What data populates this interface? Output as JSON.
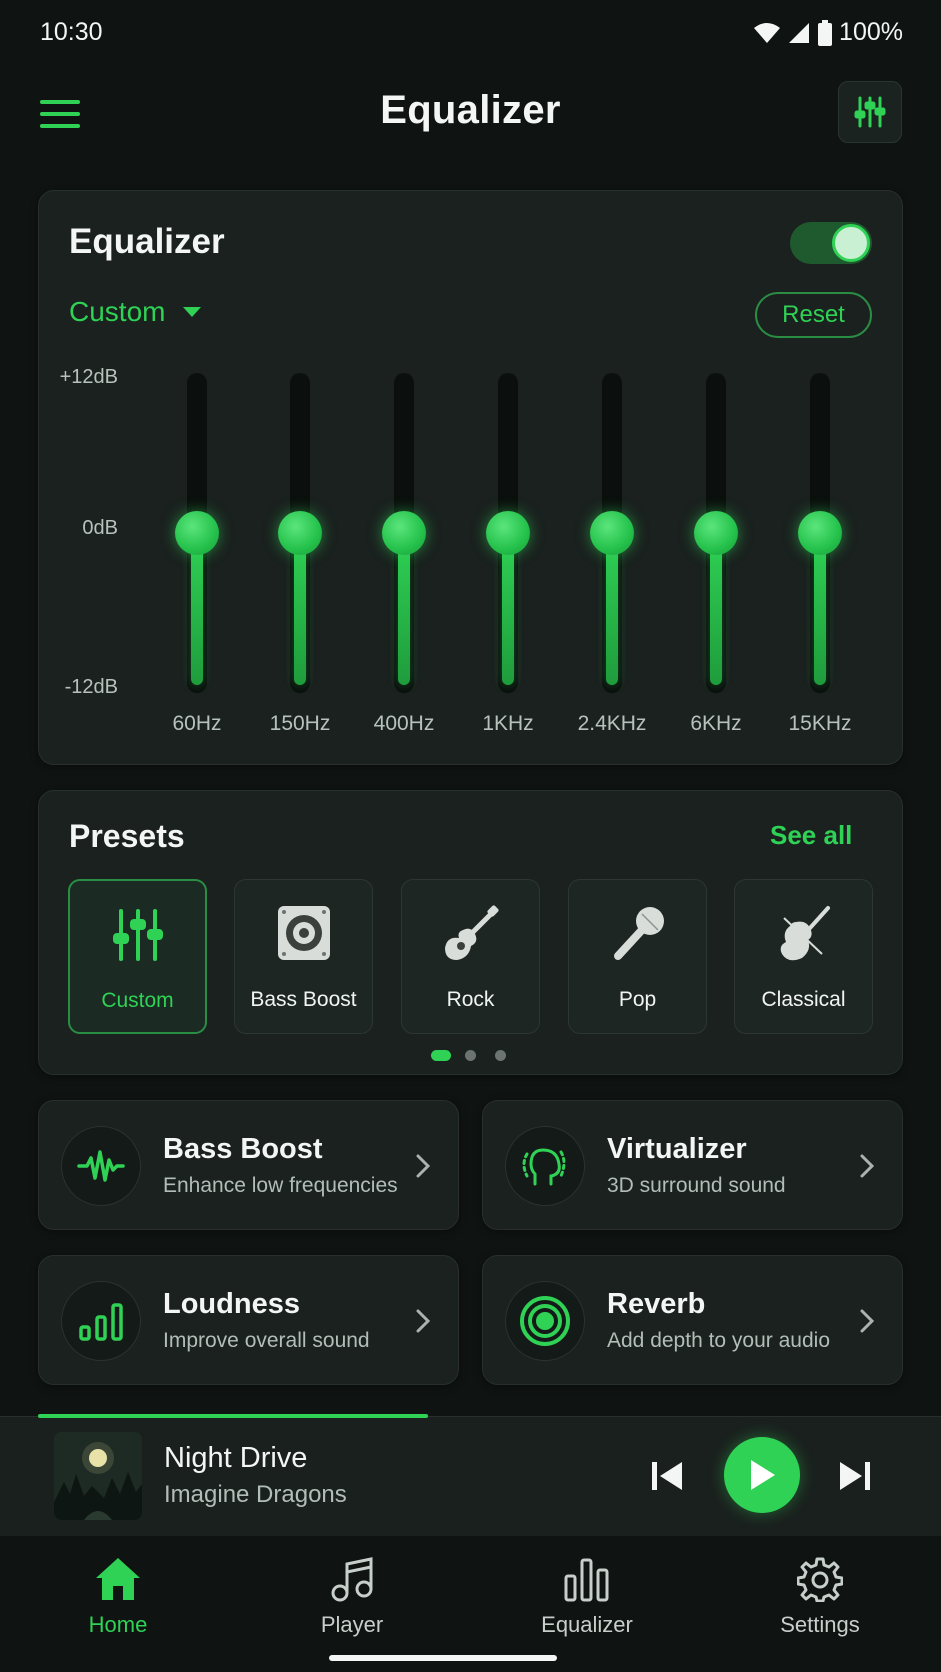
{
  "status_bar": {
    "time": "10:30",
    "battery": "100%"
  },
  "header": {
    "title": "Equalizer"
  },
  "equalizer": {
    "title": "Equalizer",
    "enabled": true,
    "preset": "Custom",
    "reset_label": "Reset",
    "db_labels": {
      "max": "+12dB",
      "mid": "0dB",
      "min": "-12dB"
    },
    "bands": [
      {
        "freq": "60Hz",
        "gain_db": 0
      },
      {
        "freq": "150Hz",
        "gain_db": 0
      },
      {
        "freq": "400Hz",
        "gain_db": 0
      },
      {
        "freq": "1KHz",
        "gain_db": 0
      },
      {
        "freq": "2.4KHz",
        "gain_db": 0
      },
      {
        "freq": "6KHz",
        "gain_db": 0
      },
      {
        "freq": "15KHz",
        "gain_db": 0
      }
    ]
  },
  "presets": {
    "title": "Presets",
    "see_all": "See all",
    "items": [
      {
        "label": "Custom",
        "icon": "sliders-icon",
        "active": true
      },
      {
        "label": "Bass Boost",
        "icon": "speaker-icon",
        "active": false
      },
      {
        "label": "Rock",
        "icon": "guitar-icon",
        "active": false
      },
      {
        "label": "Pop",
        "icon": "microphone-icon",
        "active": false
      },
      {
        "label": "Classical",
        "icon": "violin-icon",
        "active": false
      }
    ],
    "page_index": 0,
    "page_count": 3
  },
  "features": [
    {
      "title": "Bass Boost",
      "subtitle": "Enhance low frequencies",
      "icon": "waveform-icon"
    },
    {
      "title": "Virtualizer",
      "subtitle": "3D surround sound",
      "icon": "head-surround-icon"
    },
    {
      "title": "Loudness",
      "subtitle": "Improve overall sound",
      "icon": "level-bars-icon"
    },
    {
      "title": "Reverb",
      "subtitle": "Add depth to your audio",
      "icon": "concentric-rings-icon"
    }
  ],
  "player": {
    "track_title": "Night Drive",
    "artist": "Imagine Dragons",
    "progress": 0.42
  },
  "bottom_nav": [
    {
      "label": "Home",
      "icon": "home-icon",
      "active": true
    },
    {
      "label": "Player",
      "icon": "music-note-icon",
      "active": false
    },
    {
      "label": "Equalizer",
      "icon": "bar-chart-icon",
      "active": false
    },
    {
      "label": "Settings",
      "icon": "gear-icon",
      "active": false
    }
  ],
  "colors": {
    "accent": "#2fd255",
    "background": "#0f1312",
    "card": "#1a211f"
  }
}
